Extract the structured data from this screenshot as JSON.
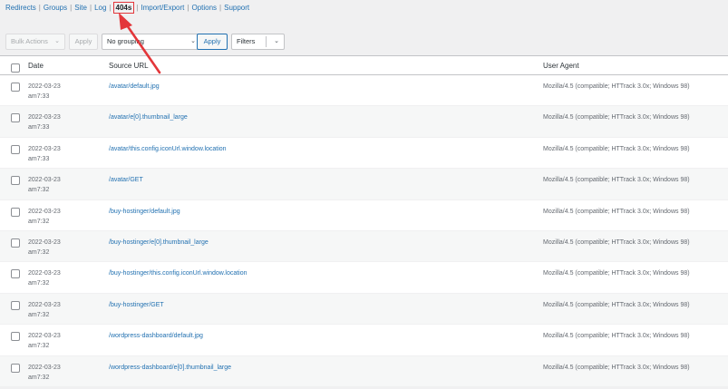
{
  "subnav": {
    "items": [
      {
        "label": "Redirects"
      },
      {
        "label": "Groups"
      },
      {
        "label": "Site"
      },
      {
        "label": "Log"
      },
      {
        "label": "404s"
      },
      {
        "label": "Import/Export"
      },
      {
        "label": "Options"
      },
      {
        "label": "Support"
      }
    ],
    "separator": "|"
  },
  "toolbar": {
    "bulk_actions": "Bulk Actions",
    "apply_top": "Apply",
    "grouping": "No grouping",
    "apply_group": "Apply",
    "filters": "Filters"
  },
  "table": {
    "headers": {
      "date": "Date",
      "source": "Source URL",
      "agent": "User Agent"
    },
    "rows": [
      {
        "date": "2022-03-23",
        "time": "am7:33",
        "url": "/avatar/default.jpg",
        "agent": "Mozilla/4.5 (compatible; HTTrack 3.0x; Windows 98)"
      },
      {
        "date": "2022-03-23",
        "time": "am7:33",
        "url": "/avatar/e[0].thumbnail_large",
        "agent": "Mozilla/4.5 (compatible; HTTrack 3.0x; Windows 98)"
      },
      {
        "date": "2022-03-23",
        "time": "am7:33",
        "url": "/avatar/this.config.iconUrl.window.location",
        "agent": "Mozilla/4.5 (compatible; HTTrack 3.0x; Windows 98)"
      },
      {
        "date": "2022-03-23",
        "time": "am7:32",
        "url": "/avatar/GET",
        "agent": "Mozilla/4.5 (compatible; HTTrack 3.0x; Windows 98)"
      },
      {
        "date": "2022-03-23",
        "time": "am7:32",
        "url": "/buy-hostinger/default.jpg",
        "agent": "Mozilla/4.5 (compatible; HTTrack 3.0x; Windows 98)"
      },
      {
        "date": "2022-03-23",
        "time": "am7:32",
        "url": "/buy-hostinger/e[0].thumbnail_large",
        "agent": "Mozilla/4.5 (compatible; HTTrack 3.0x; Windows 98)"
      },
      {
        "date": "2022-03-23",
        "time": "am7:32",
        "url": "/buy-hostinger/this.config.iconUrl.window.location",
        "agent": "Mozilla/4.5 (compatible; HTTrack 3.0x; Windows 98)"
      },
      {
        "date": "2022-03-23",
        "time": "am7:32",
        "url": "/buy-hostinger/GET",
        "agent": "Mozilla/4.5 (compatible; HTTrack 3.0x; Windows 98)"
      },
      {
        "date": "2022-03-23",
        "time": "am7:32",
        "url": "/wordpress-dashboard/default.jpg",
        "agent": "Mozilla/4.5 (compatible; HTTrack 3.0x; Windows 98)"
      },
      {
        "date": "2022-03-23",
        "time": "am7:32",
        "url": "/wordpress-dashboard/e[0].thumbnail_large",
        "agent": "Mozilla/4.5 (compatible; HTTrack 3.0x; Windows 98)"
      }
    ]
  },
  "colors": {
    "link": "#2271b1",
    "highlight": "#e3363a",
    "row_alt": "#f6f7f7"
  }
}
